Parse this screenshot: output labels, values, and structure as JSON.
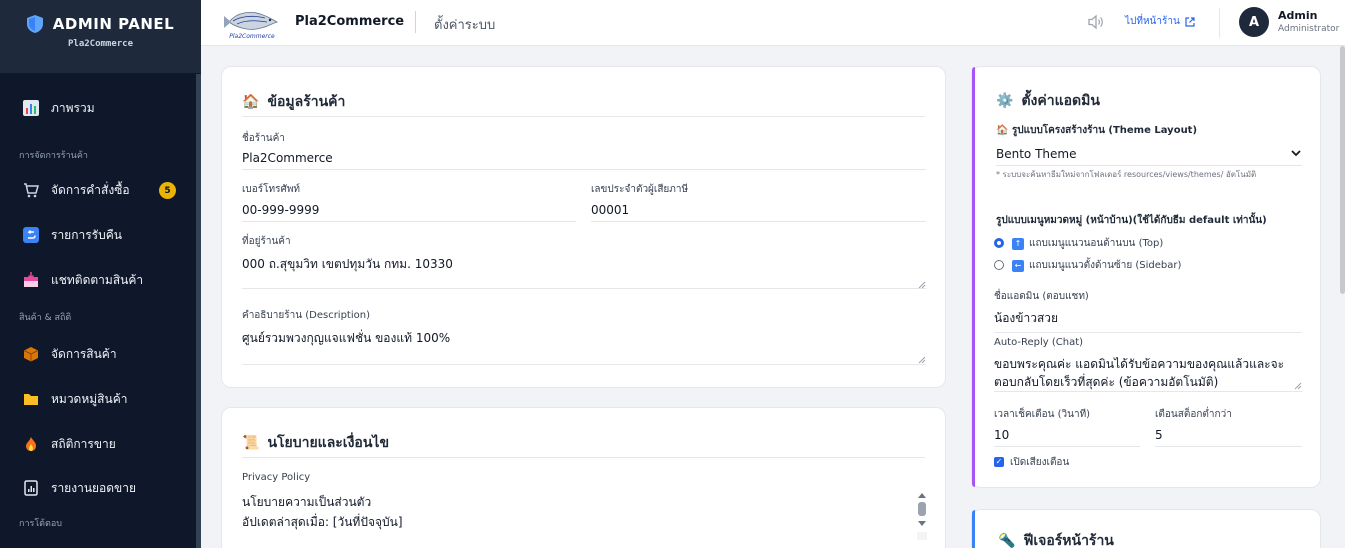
{
  "sidebar": {
    "title": "ADMIN PANEL",
    "subtitle": "Pla2Commerce",
    "items": [
      {
        "label": "ภาพรวม",
        "icon": "chart-bar-icon"
      },
      {
        "label": "จัดการคำสั่งซื้อ",
        "icon": "cart-icon",
        "badge": "5"
      },
      {
        "label": "รายการรับคืน",
        "icon": "return-icon"
      },
      {
        "label": "แชทติดตามสินค้า",
        "icon": "inbox-icon"
      },
      {
        "label": "จัดการสินค้า",
        "icon": "box-icon"
      },
      {
        "label": "หมวดหมู่สินค้า",
        "icon": "folder-icon"
      },
      {
        "label": "สถิติการขาย",
        "icon": "fire-icon"
      },
      {
        "label": "รายงานยอดขาย",
        "icon": "report-icon"
      }
    ],
    "sections": [
      "การจัดการร้านค้า",
      "สินค้า & สถิติ",
      "การโต้ตอบ"
    ]
  },
  "topbar": {
    "store_name": "Pla2Commerce",
    "page_title": "ตั้งค่าระบบ",
    "go_store": "ไปที่หน้าร้าน",
    "avatar_letter": "A",
    "admin_name": "Admin",
    "admin_role": "Administrator",
    "logo_text": "Pla2Commerce"
  },
  "store_info": {
    "title": "ข้อมูลร้านค้า",
    "name_label": "ชื่อร้านค้า",
    "name_value": "Pla2Commerce",
    "phone_label": "เบอร์โทรศัพท์",
    "phone_value": "00-999-9999",
    "tax_label": "เลขประจำตัวผู้เสียภาษี",
    "tax_value": "00001",
    "address_label": "ที่อยู่ร้านค้า",
    "address_value": "000 ถ.สุขุมวิท เขตปทุมวัน กทม. 10330",
    "desc_label": "คำอธิบายร้าน (Description)",
    "desc_value": "ศูนย์รวมพวงกุญแจแฟชั่น ของแท้ 100%"
  },
  "policy": {
    "title": "นโยบายและเงื่อนไข",
    "privacy_label": "Privacy Policy",
    "privacy_line1": "นโยบายความเป็นส่วนตัว",
    "privacy_line2": "อัปเดตล่าสุดเมื่อ: [วันที่ปัจจุบัน]"
  },
  "admin_settings": {
    "title": "ตั้งค่าแอดมิน",
    "theme_label": "รูปแบบโครงสร้างร้าน (Theme Layout)",
    "theme_value": "Bento Theme",
    "theme_note": "* ระบบจะค้นหาธีมใหม่จากโฟลเดอร์ resources/views/themes/ อัตโนมัติ",
    "menu_label": "รูปแบบเมนูหมวดหมู่ (หน้าบ้าน)(ใช้ได้กับธีม default เท่านั้น)",
    "menu_opt_top": "แถบเมนูแนวนอนด้านบน (Top)",
    "menu_opt_side": "แถบเมนูแนวตั้งด้านซ้าย (Sidebar)",
    "admin_name_label": "ชื่อแอดมิน (ตอบแชท)",
    "admin_name_value": "น้องข้าวสวย",
    "autoreply_label": "Auto-Reply (Chat)",
    "autoreply_line1": "ขอบพระคุณค่ะ แอดมินได้รับข้อความของคุณแล้วและจะ",
    "autoreply_line2": "ตอบกลับโดยเร็วที่สุดค่ะ (ข้อความอัตโนมัติ)",
    "check_label": "เวลาเช็คเตือน (วินาที)",
    "check_value": "10",
    "stock_label": "เตือนสต็อกต่ำกว่า",
    "stock_value": "5",
    "sound_label": "เปิดเสียงเตือน"
  },
  "features": {
    "title": "ฟีเจอร์หน้าร้าน"
  },
  "colors": {
    "sidebar_bg": "#0f172a",
    "accent": "#2563eb",
    "admin_card_border": "#a855f7",
    "feature_card_border": "#3b82f6",
    "badge": "#eab308"
  }
}
